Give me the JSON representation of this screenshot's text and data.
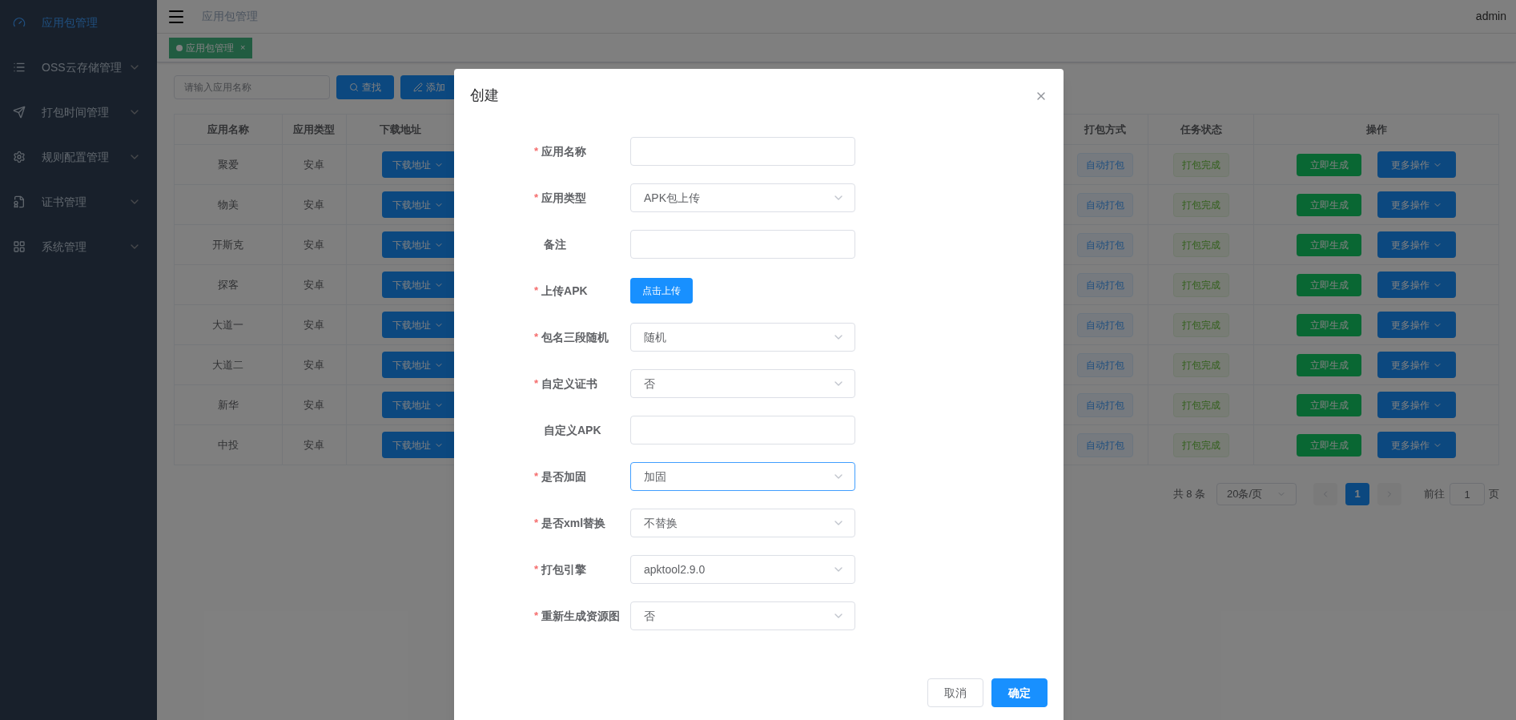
{
  "sidebar": {
    "items": [
      {
        "label": "应用包管理",
        "selected": true,
        "expandable": false
      },
      {
        "label": "OSS云存储管理",
        "selected": false,
        "expandable": true
      },
      {
        "label": "打包时间管理",
        "selected": false,
        "expandable": true
      },
      {
        "label": "规则配置管理",
        "selected": false,
        "expandable": true
      },
      {
        "label": "证书管理",
        "selected": false,
        "expandable": true
      },
      {
        "label": "系统管理",
        "selected": false,
        "expandable": true
      }
    ]
  },
  "header": {
    "breadcrumb": "应用包管理",
    "user": "admin"
  },
  "tags": [
    {
      "label": "应用包管理",
      "selected": true,
      "close": "×"
    }
  ],
  "toolbar": {
    "search": {
      "placeholder": "请输入应用名称"
    },
    "buttons": [
      {
        "label": "查找"
      },
      {
        "label": "添加"
      }
    ]
  },
  "table": {
    "columns": [
      "应用名称",
      "应用类型",
      "下载地址",
      "打包方式",
      "任务状态",
      "操作"
    ],
    "rows": [
      {
        "name": "聚爱",
        "type": "安卓",
        "download": "下载地址",
        "method": "自动打包",
        "status": "打包完成",
        "action": "立即生成",
        "more": "更多操作"
      },
      {
        "name": "物美",
        "type": "安卓",
        "download": "下载地址",
        "method": "自动打包",
        "status": "打包完成",
        "action": "立即生成",
        "more": "更多操作"
      },
      {
        "name": "开斯克",
        "type": "安卓",
        "download": "下载地址",
        "method": "自动打包",
        "status": "打包完成",
        "action": "立即生成",
        "more": "更多操作"
      },
      {
        "name": "探客",
        "type": "安卓",
        "download": "下载地址",
        "method": "自动打包",
        "status": "打包完成",
        "action": "立即生成",
        "more": "更多操作"
      },
      {
        "name": "大道一",
        "type": "安卓",
        "download": "下载地址",
        "method": "自动打包",
        "status": "打包完成",
        "action": "立即生成",
        "more": "更多操作"
      },
      {
        "name": "大道二",
        "type": "安卓",
        "download": "下载地址",
        "method": "自动打包",
        "status": "打包完成",
        "action": "立即生成",
        "more": "更多操作"
      },
      {
        "name": "新华",
        "type": "安卓",
        "download": "下载地址",
        "method": "自动打包",
        "status": "打包完成",
        "action": "立即生成",
        "more": "更多操作"
      },
      {
        "name": "中投",
        "type": "安卓",
        "download": "下载地址",
        "method": "自动打包",
        "status": "打包完成",
        "action": "立即生成",
        "more": "更多操作"
      }
    ]
  },
  "pagination": {
    "total": "共 8 条",
    "page_size": "20条/页",
    "pages": [
      {
        "label": "1",
        "selected": true
      }
    ],
    "goto_label": "前往",
    "goto_value": "1",
    "goto_suffix": "页"
  },
  "dialog": {
    "title": "创建",
    "fields": [
      {
        "label": "应用名称",
        "kind": "input",
        "required_mark": "*"
      },
      {
        "label": "应用类型",
        "kind": "select",
        "value": "APK包上传",
        "required_mark": "*"
      },
      {
        "label": "备注",
        "kind": "input"
      },
      {
        "label": "上传APK",
        "kind": "upload",
        "value": "点击上传",
        "required_mark": "*"
      },
      {
        "label": "包名三段随机",
        "kind": "select",
        "value": "随机",
        "required_mark": "*"
      },
      {
        "label": "自定义证书",
        "kind": "select",
        "value": "否",
        "required_mark": "*"
      },
      {
        "label": "自定义APK",
        "kind": "input"
      },
      {
        "label": "是否加固",
        "kind": "select",
        "value": "加固",
        "required_mark": "*",
        "focused": true
      },
      {
        "label": "是否xml替换",
        "kind": "select",
        "value": "不替换",
        "required_mark": "*"
      },
      {
        "label": "打包引擎",
        "kind": "select",
        "value": "apktool2.9.0",
        "required_mark": "*"
      },
      {
        "label": "重新生成资源图",
        "kind": "select",
        "value": "否",
        "required_mark": "*"
      }
    ],
    "buttons": [
      {
        "label": "取消",
        "kind": "secondary"
      },
      {
        "label": "确定",
        "kind": "primary"
      }
    ]
  }
}
